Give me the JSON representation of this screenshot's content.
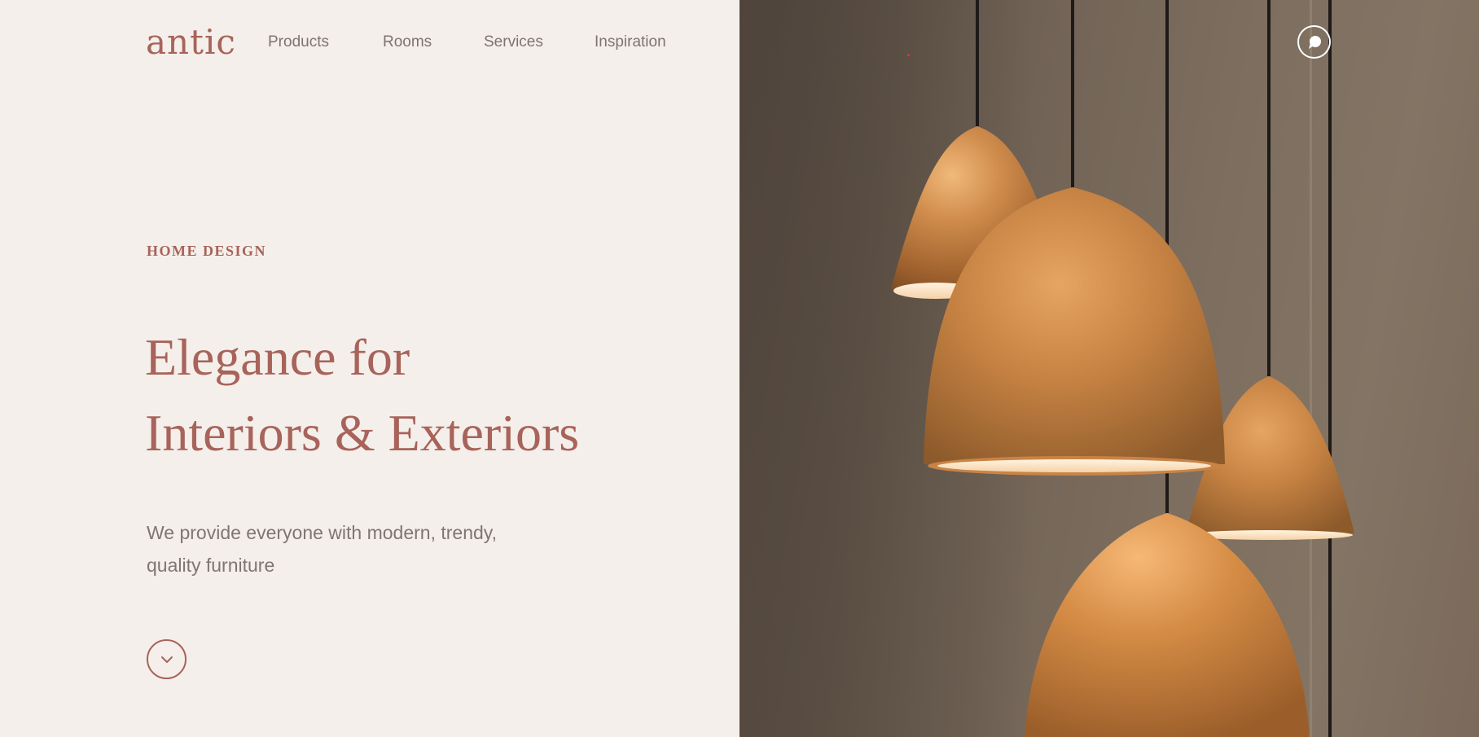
{
  "brand": {
    "logo": "antic"
  },
  "nav": {
    "items": [
      "Products",
      "Rooms",
      "Services",
      "Inspiration"
    ]
  },
  "hero": {
    "eyebrow": "HOME DESIGN",
    "headline_line1": "Elegance for",
    "headline_line2": "Interiors & Exteriors",
    "subtitle_line1": "We provide everyone with modern, trendy,",
    "subtitle_line2": "quality furniture"
  },
  "icons": {
    "scroll": "chevron-down-icon",
    "chat": "chat-bubble-icon"
  },
  "colors": {
    "background": "#f4efea",
    "accent": "#a8635a",
    "text_muted": "#7d7470",
    "lamp_copper": "#c8884c"
  }
}
